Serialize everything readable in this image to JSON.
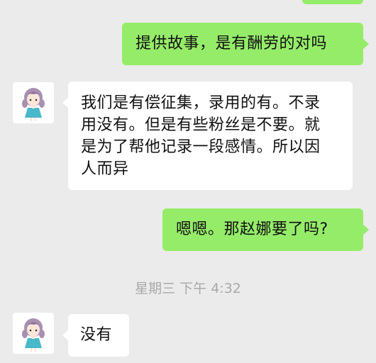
{
  "messages": [
    {
      "id": "m1",
      "side": "out",
      "text": ""
    },
    {
      "id": "m2",
      "side": "out",
      "text": "提供故事，是有酬劳的对吗"
    },
    {
      "id": "m3",
      "side": "in",
      "lines": [
        "我们是有偿征集，录用的有。不录",
        "用没有。但是有些粉丝是不要。就",
        "是为了帮他记录一段感情。所以因",
        "人而异"
      ]
    },
    {
      "id": "m4",
      "side": "out",
      "text": "嗯嗯。那赵娜要了吗?"
    },
    {
      "id": "m5",
      "side": "in",
      "text": "没有"
    }
  ],
  "timestamp": "星期三 下午 4:32",
  "avatar": {
    "icon": "girl-avatar-icon"
  },
  "colors": {
    "background": "#ebebeb",
    "outgoing_bubble": "#95ec69",
    "incoming_bubble": "#ffffff",
    "timestamp": "#a9a9a9"
  }
}
